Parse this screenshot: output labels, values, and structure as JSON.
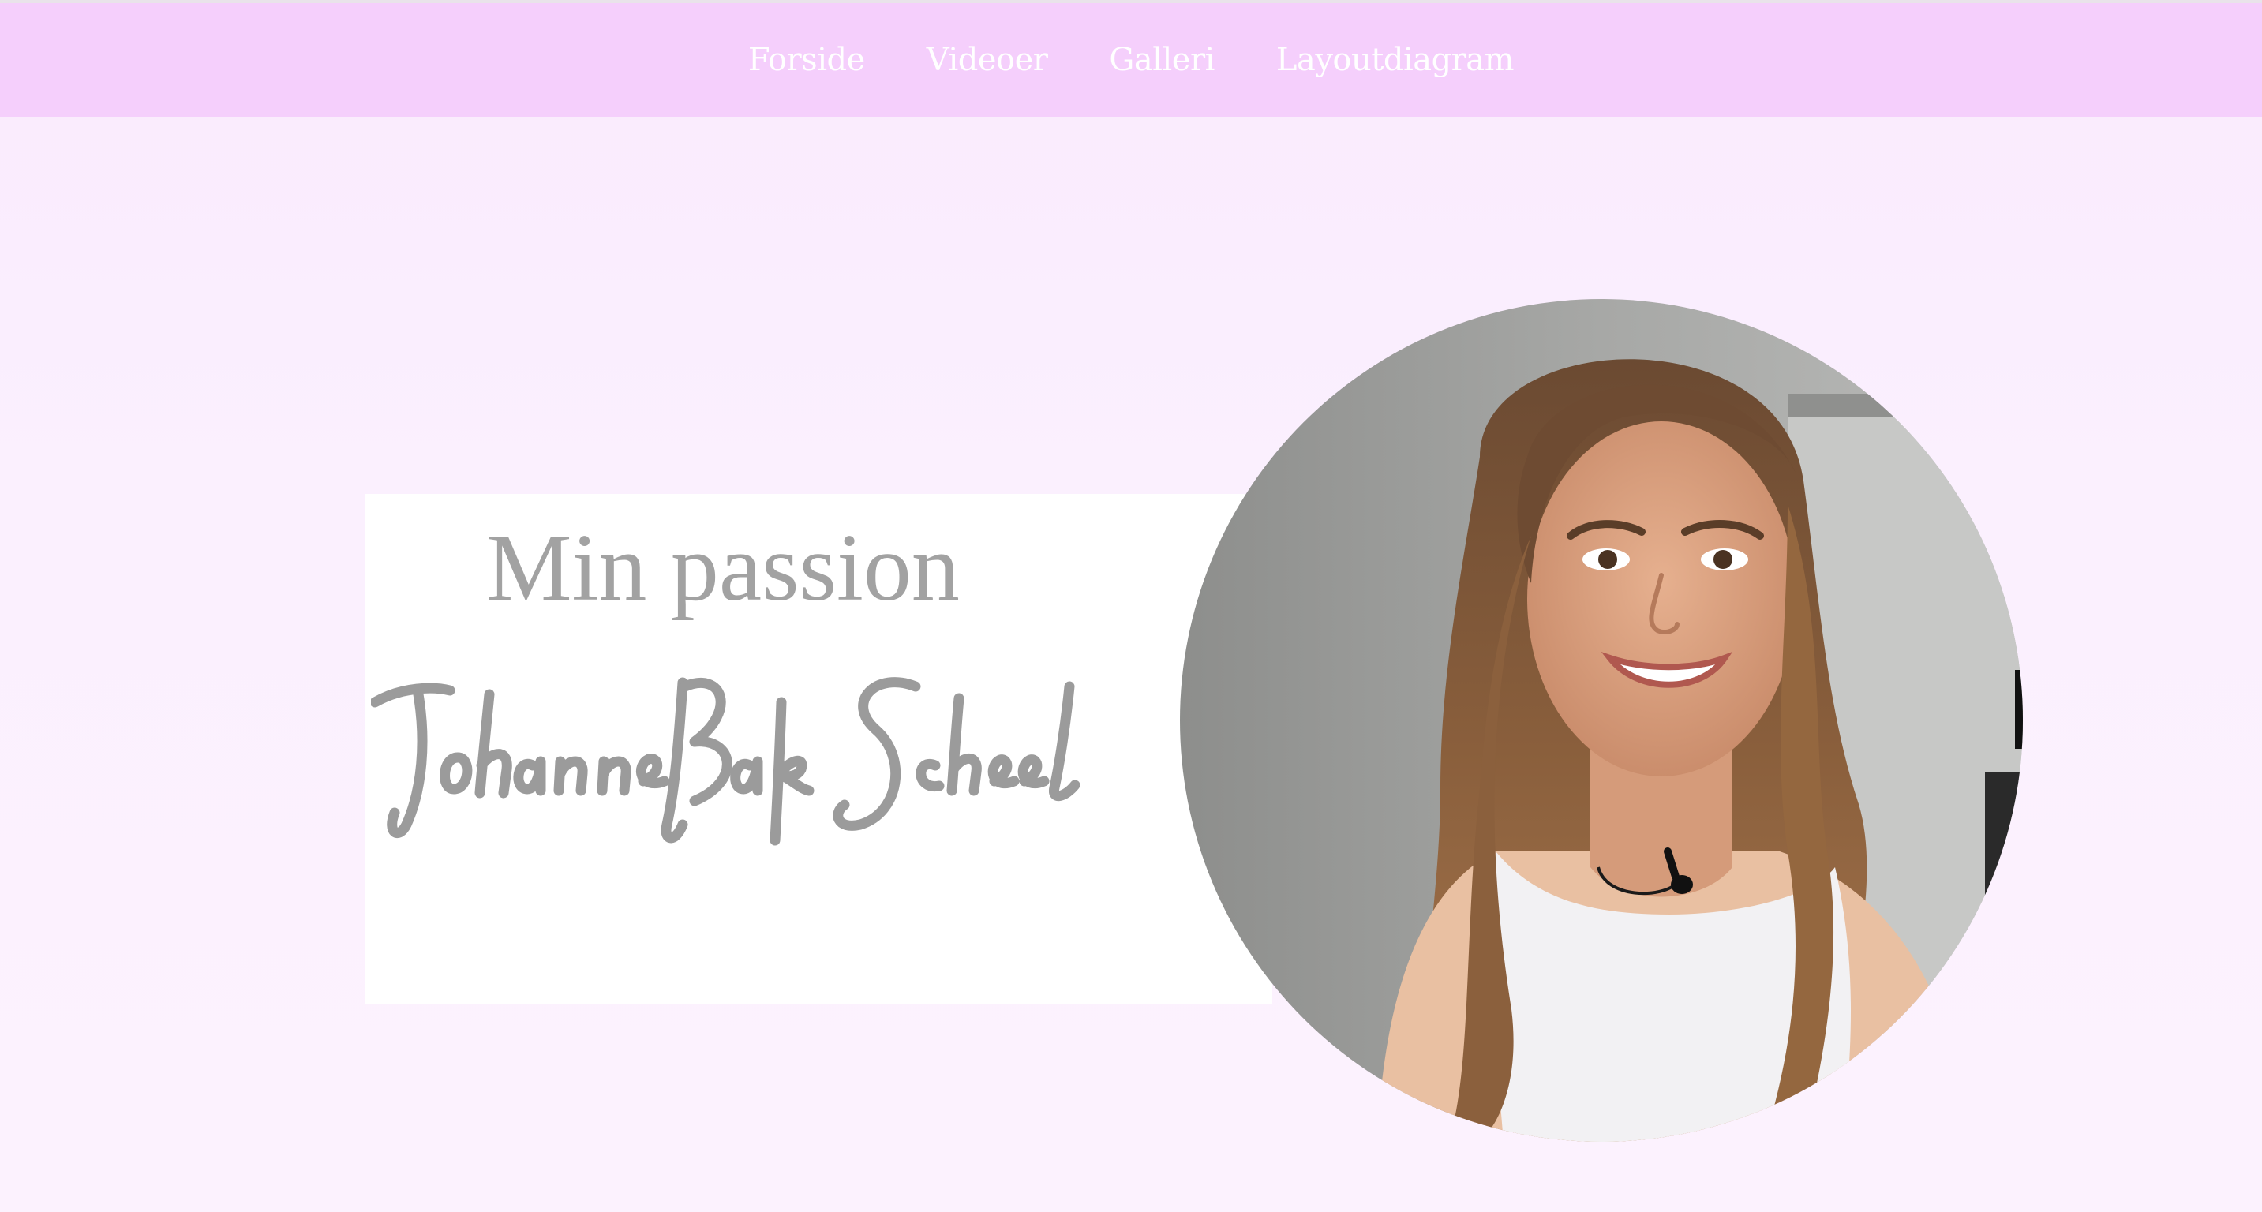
{
  "nav": {
    "items": [
      {
        "label": "Forside"
      },
      {
        "label": "Videoer"
      },
      {
        "label": "Galleri"
      },
      {
        "label": "Layoutdiagram"
      }
    ]
  },
  "hero": {
    "heading": "Min passion",
    "signature": "Johanne Bak Scheel",
    "portrait": "portrait-photo"
  },
  "colors": {
    "nav_background": "#f5cffc",
    "nav_text": "#ffffff",
    "page_background": "#fbf0fe",
    "heading_text": "#a2a2a2"
  }
}
